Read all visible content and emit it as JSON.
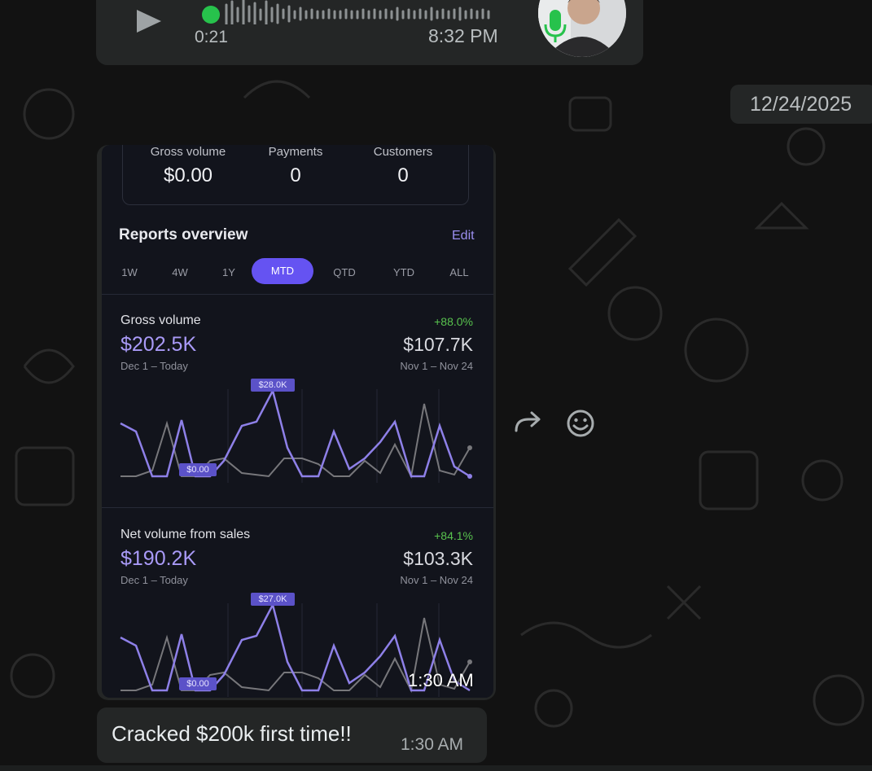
{
  "voice_message": {
    "duration": "0:21",
    "time": "8:32 PM"
  },
  "date_separator": "12/24/2025",
  "image_message": {
    "time": "1:30 AM",
    "stats": [
      {
        "label": "Gross volume",
        "value": "$0.00"
      },
      {
        "label": "Payments",
        "value": "0"
      },
      {
        "label": "Customers",
        "value": "0"
      }
    ],
    "reports_title": "Reports overview",
    "edit_label": "Edit",
    "ranges": [
      "1W",
      "4W",
      "1Y",
      "MTD",
      "QTD",
      "YTD",
      "ALL"
    ],
    "active_range": "MTD",
    "panels": [
      {
        "label": "Gross volume",
        "change": "+88.0%",
        "current": "$202.5K",
        "current_range": "Dec 1 – Today",
        "previous": "$107.7K",
        "previous_range": "Nov 1 – Nov 24",
        "max_tag": "$28.0K",
        "min_tag": "$0.00"
      },
      {
        "label": "Net volume from sales",
        "change": "+84.1%",
        "current": "$190.2K",
        "current_range": "Dec 1 – Today",
        "previous": "$103.3K",
        "previous_range": "Nov 1 – Nov 24",
        "max_tag": "$27.0K",
        "min_tag": "$0.00"
      }
    ]
  },
  "text_message": {
    "text": "Cracked $200k first time!!",
    "time": "1:30 AM"
  },
  "colors": {
    "bubble": "#242626",
    "accent": "#6553f2",
    "positive": "#58c24e",
    "current_line": "#8e80e8",
    "previous_line": "#7a7a7e"
  }
}
